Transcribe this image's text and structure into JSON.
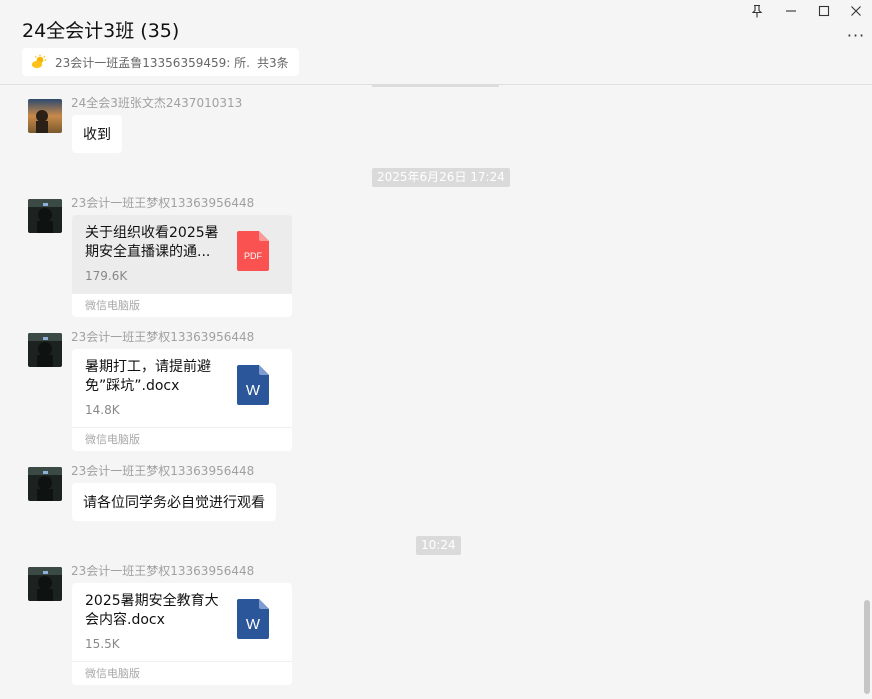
{
  "window": {
    "title": "24全会计3班 (35)",
    "controls": {
      "pin": "⊥",
      "minimize": "—",
      "maximize": "☐",
      "close": "✕",
      "more": "···"
    }
  },
  "pinned": {
    "text": "23会计一班孟鲁13356359459: 所...",
    "count": "共3条"
  },
  "messages": [
    {
      "sender": "24全会3班张文杰2437010313",
      "text": "收到"
    },
    {
      "time": "2025年6月26日 17:24"
    },
    {
      "sender": "23会计一班王梦权13363956448",
      "file": {
        "name": "关于组织收看2025暑期安全直播课的通...",
        "size": "179.6K",
        "type": "PDF",
        "type_label": "PDF",
        "source": "微信电脑版"
      }
    },
    {
      "sender": "23会计一班王梦权13363956448",
      "file": {
        "name": "暑期打工，请提前避免”踩坑”.docx",
        "size": "14.8K",
        "type": "WORD",
        "type_label": "W",
        "source": "微信电脑版"
      }
    },
    {
      "sender": "23会计一班王梦权13363956448",
      "text": "请各位同学务必自觉进行观看"
    },
    {
      "time": "10:24"
    },
    {
      "sender": "23会计一班王梦权13363956448",
      "file": {
        "name": "2025暑期安全教育大会内容.docx",
        "size": "15.5K",
        "type": "WORD",
        "type_label": "W",
        "source": "微信电脑版"
      }
    }
  ],
  "colors": {
    "pdf": "#fa5151",
    "word": "#2b579a",
    "background": "#f5f5f5"
  }
}
